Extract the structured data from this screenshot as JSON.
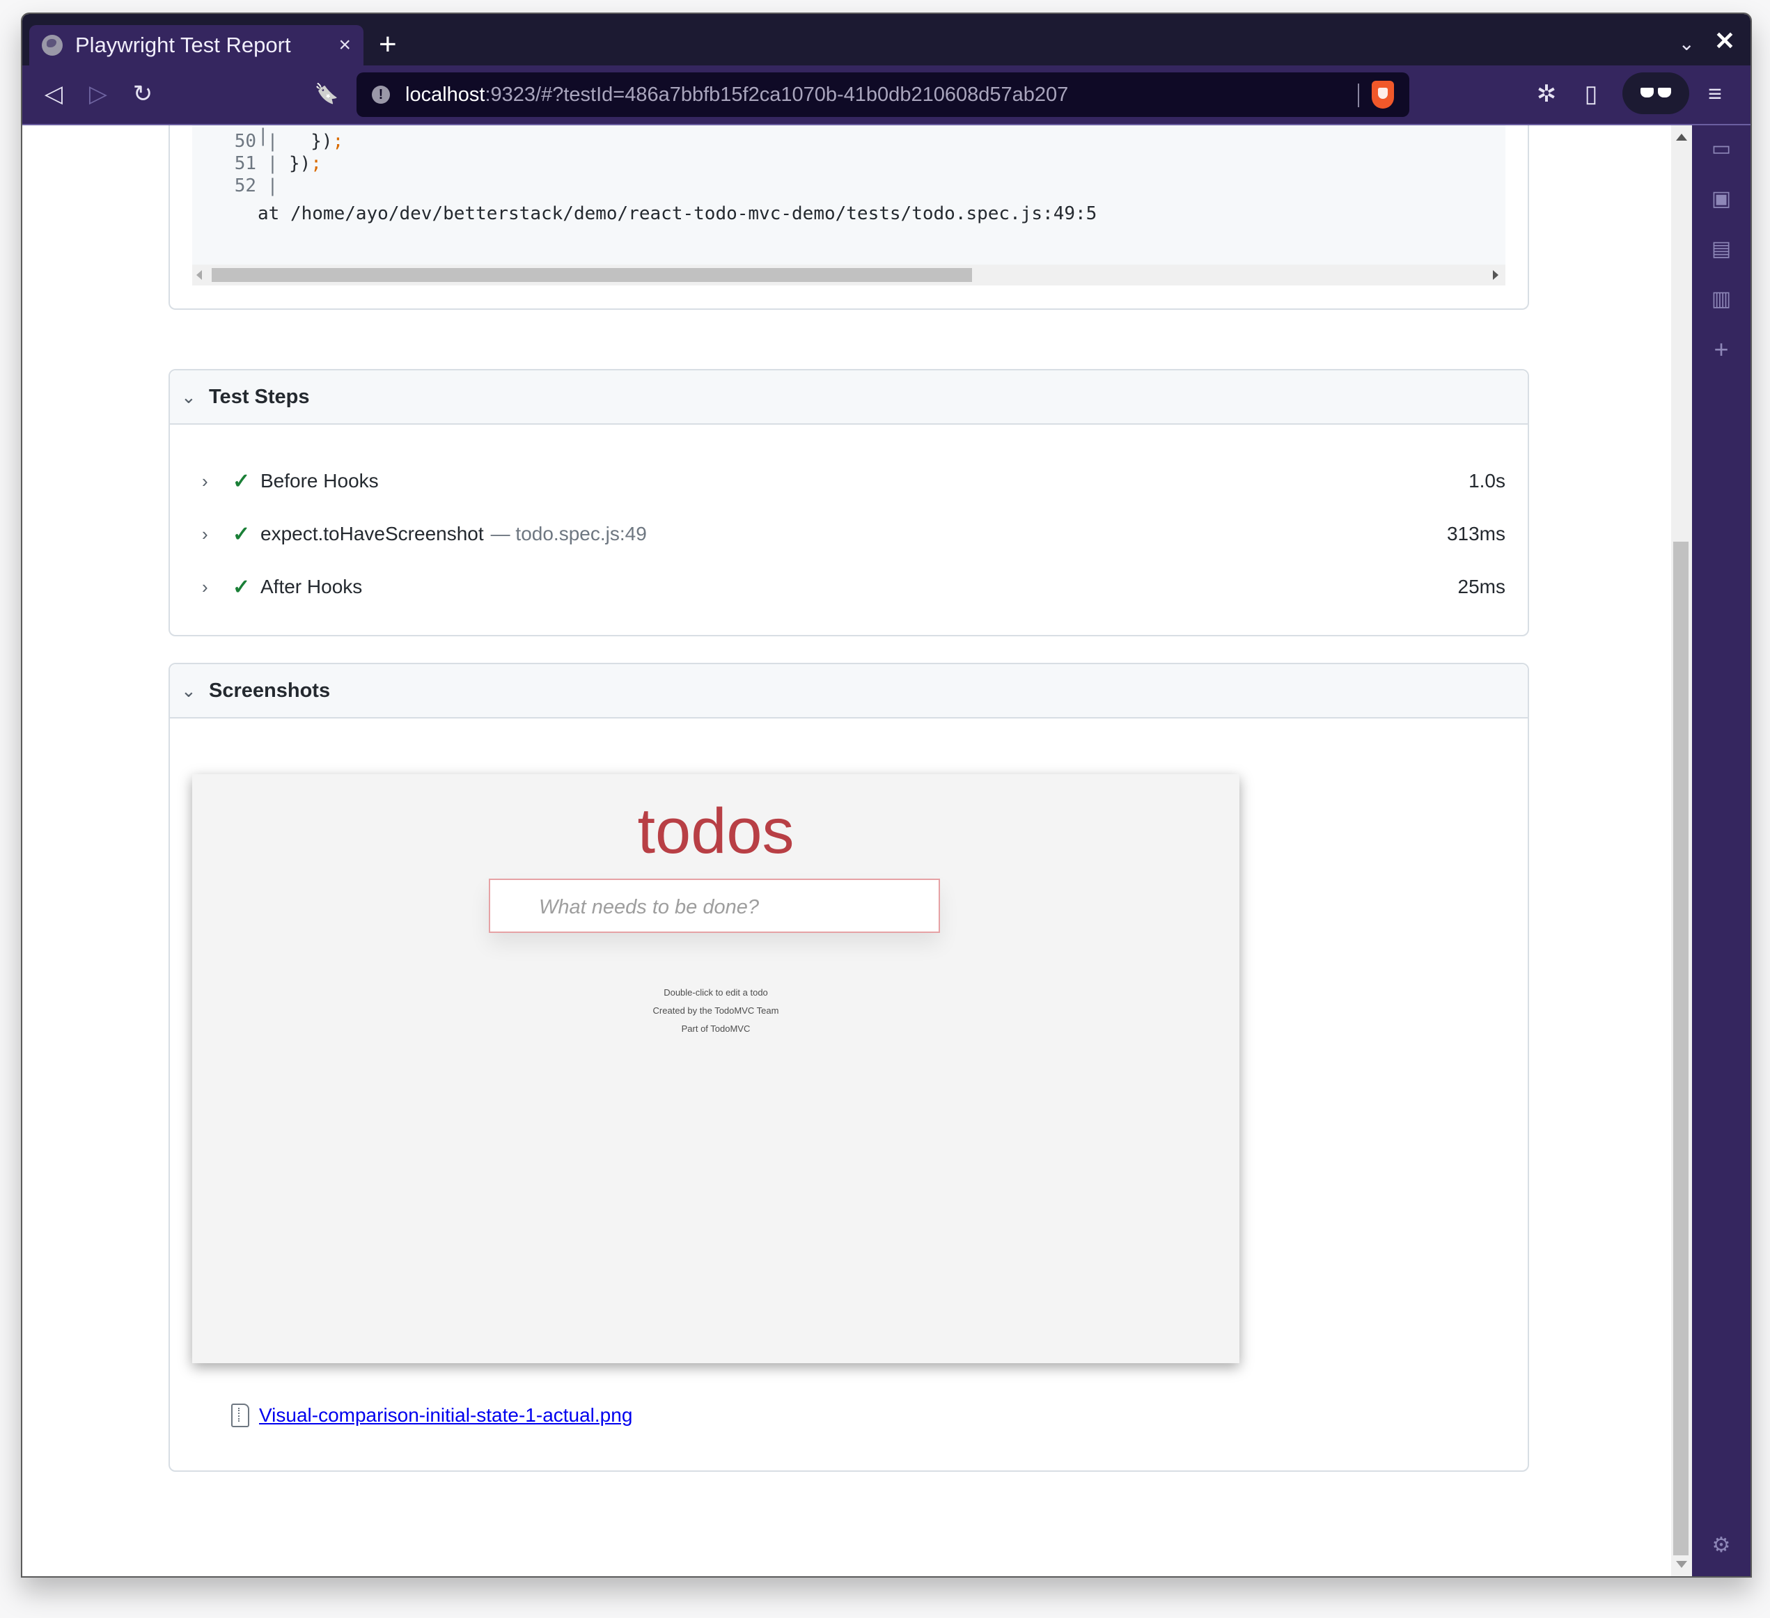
{
  "browser": {
    "tab_title": "Playwright Test Report",
    "tab_close": "×",
    "new_tab": "+",
    "tabs_menu": "⌄",
    "window_close": "✕",
    "url_host": "localhost",
    "url_path": ":9323/#?testId=486a7bbfb15f2ca1070b-41b0db210608d57ab207",
    "icons": {
      "back": "◁",
      "forward": "▷",
      "reload": "↻",
      "bookmark": "🔖",
      "extensions": "✲",
      "sidebar_toggle": "▯",
      "menu": "≡"
    },
    "sidebar_icons": {
      "video": "▭",
      "wallet": "▣",
      "bookmarks": "▤",
      "reading_list": "▥",
      "add": "+",
      "settings": "⚙"
    }
  },
  "error": {
    "code_lines": [
      {
        "num": "",
        "text": "",
        "punct": ""
      },
      {
        "num": "50",
        "text": "   })",
        "punct": ";"
      },
      {
        "num": "51",
        "text": " })",
        "punct": ";"
      },
      {
        "num": "52",
        "text": "",
        "punct": ""
      }
    ],
    "stack_location": "at /home/ayo/dev/betterstack/demo/react-todo-mvc-demo/tests/todo.spec.js:49:5"
  },
  "test_steps": {
    "title": "Test Steps",
    "steps": [
      {
        "title": "Before Hooks",
        "location": "",
        "duration": "1.0s",
        "status": "passed"
      },
      {
        "title": "expect.toHaveScreenshot",
        "location": "— todo.spec.js:49",
        "duration": "313ms",
        "status": "passed"
      },
      {
        "title": "After Hooks",
        "location": "",
        "duration": "25ms",
        "status": "passed"
      }
    ]
  },
  "screenshots": {
    "title": "Screenshots",
    "preview": {
      "app_title": "todos",
      "input_placeholder": "What needs to be done?",
      "footer": [
        "Double-click to edit a todo",
        "Created by the TodoMVC Team",
        "Part of TodoMVC"
      ]
    },
    "attachment_name": "Visual-comparison-initial-state-1-actual.png"
  },
  "colors": {
    "toolbar": "#35265f",
    "tabstrip": "#1c1a32",
    "pass": "#1a7f37",
    "todo_red": "#b83f45",
    "link": "#0000ee"
  }
}
